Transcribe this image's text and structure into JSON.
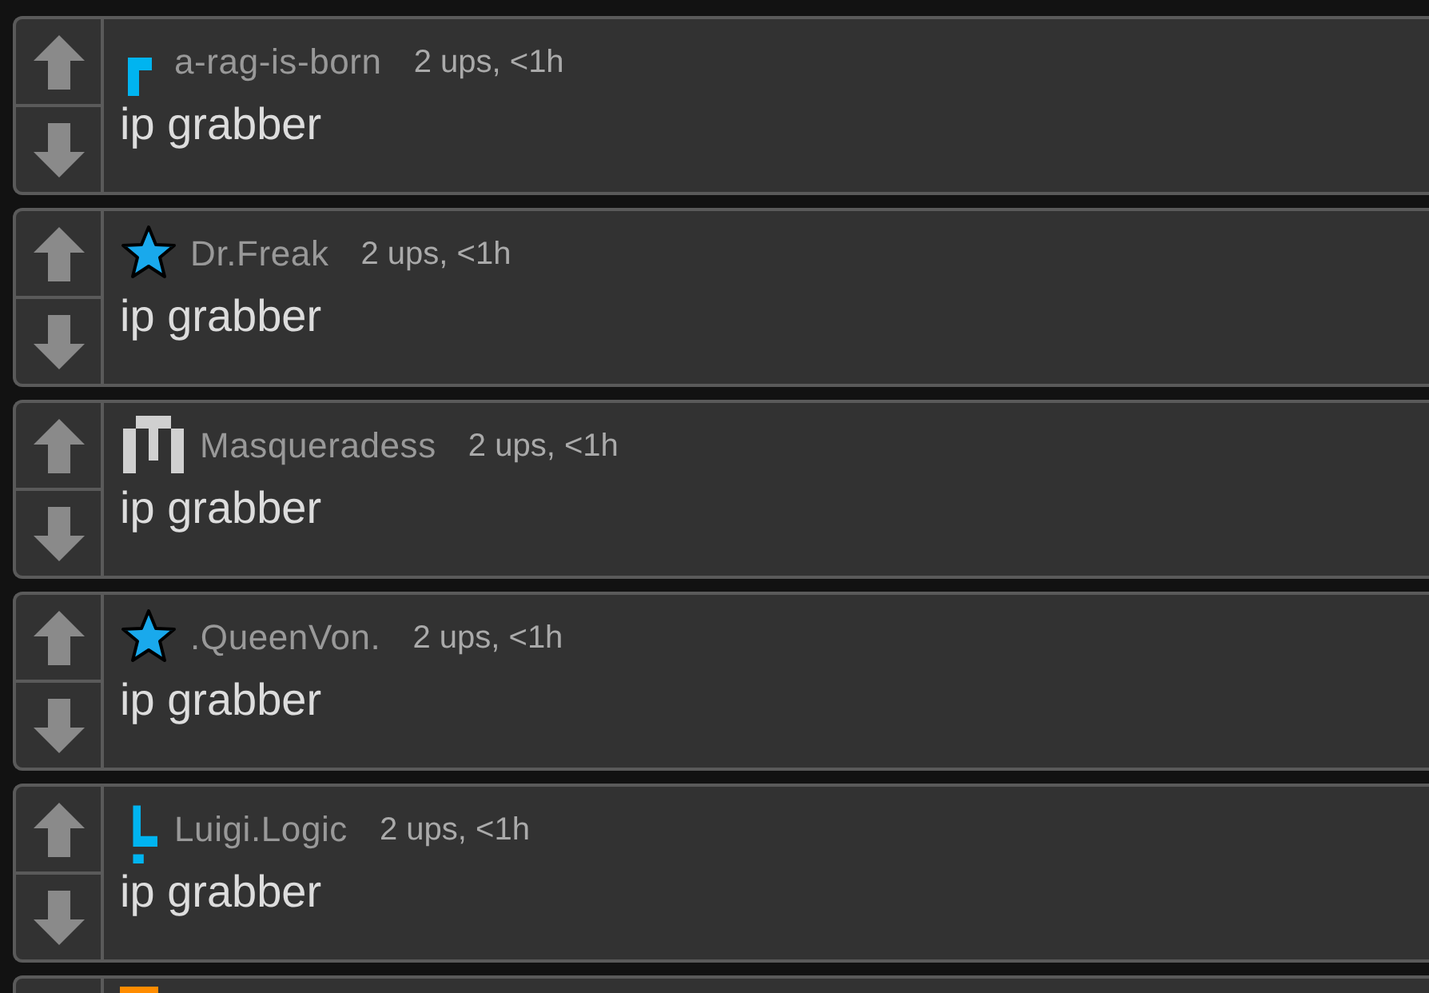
{
  "posts": [
    {
      "author": "a-rag-is-born",
      "meta": "2 ups, <1h",
      "title": "ip grabber",
      "avatar": {
        "kind": "bracket",
        "color": "#00b4f0"
      }
    },
    {
      "author": "Dr.Freak",
      "meta": "2 ups, <1h",
      "title": "ip grabber",
      "avatar": {
        "kind": "star",
        "color": "#19a9ec"
      }
    },
    {
      "author": "Masqueradess",
      "meta": "2 ups, <1h",
      "title": "ip grabber",
      "avatar": {
        "kind": "bars",
        "color": "#d0d0d0"
      }
    },
    {
      "author": ".QueenVon.",
      "meta": "2 ups, <1h",
      "title": "ip grabber",
      "avatar": {
        "kind": "star",
        "color": "#19a9ec"
      }
    },
    {
      "author": "Luigi.Logic",
      "meta": "2 ups, <1h",
      "title": "ip grabber",
      "avatar": {
        "kind": "exclaim",
        "color": "#00b4f0"
      }
    },
    {
      "avatar": {
        "kind": "block",
        "color": "#ff8c00"
      }
    }
  ]
}
